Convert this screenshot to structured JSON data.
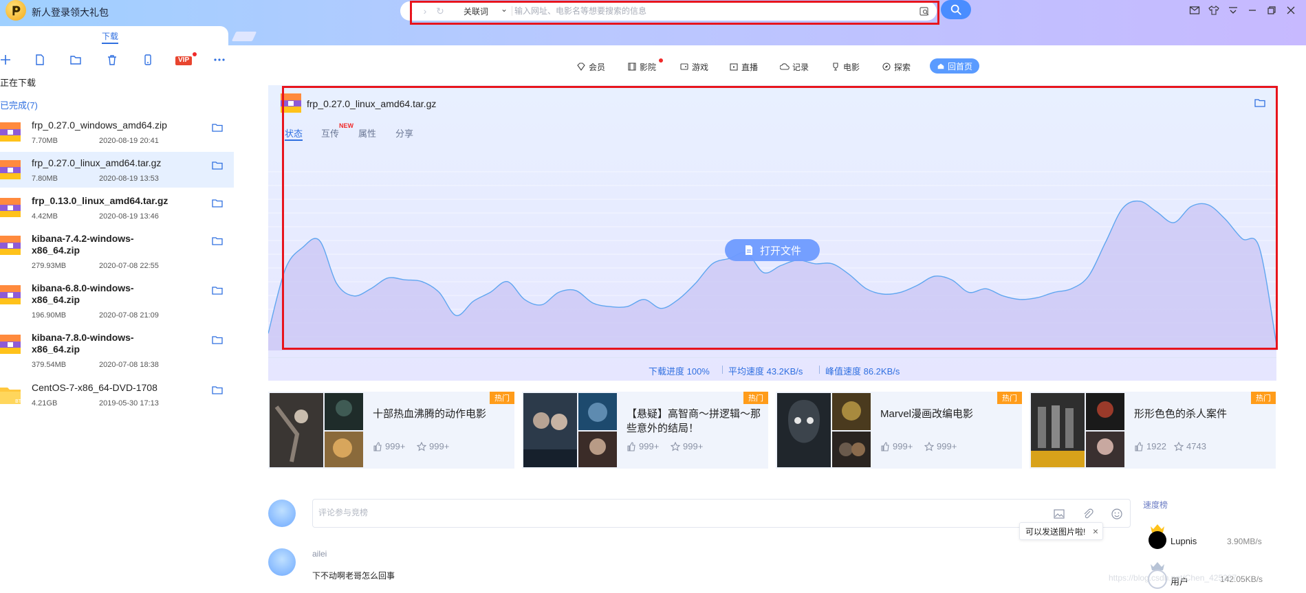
{
  "header": {
    "promo": "新人登录领大礼包",
    "search": {
      "keyword_mode": "关联词",
      "placeholder": "输入网址、电影名等想要搜索的信息"
    }
  },
  "sidebar": {
    "tab": "下载",
    "toolbar": [
      "add",
      "file",
      "folder",
      "delete",
      "mobile",
      "vip",
      "more"
    ],
    "vip_label": "VIP",
    "downloading_label": "正在下载",
    "completed_label": "已完成(7)",
    "items": [
      {
        "name": "frp_0.27.0_windows_amd64.zip",
        "size": "7.70MB",
        "date": "2020-08-19 20:41",
        "bold": false,
        "type": "archive"
      },
      {
        "name": "frp_0.27.0_linux_amd64.tar.gz",
        "size": "7.80MB",
        "date": "2020-08-19 13:53",
        "bold": false,
        "type": "archive",
        "selected": true
      },
      {
        "name": "frp_0.13.0_linux_amd64.tar.gz",
        "size": "4.42MB",
        "date": "2020-08-19 13:46",
        "bold": true,
        "type": "archive"
      },
      {
        "name": "kibana-7.4.2-windows-x86_64.zip",
        "size": "279.93MB",
        "date": "2020-07-08 22:55",
        "bold": true,
        "type": "archive"
      },
      {
        "name": "kibana-6.8.0-windows-x86_64.zip",
        "size": "196.90MB",
        "date": "2020-07-08 21:09",
        "bold": true,
        "type": "archive"
      },
      {
        "name": "kibana-7.8.0-windows-x86_64.zip",
        "size": "379.54MB",
        "date": "2020-07-08 18:38",
        "bold": true,
        "type": "archive"
      },
      {
        "name": "CentOS-7-x86_64-DVD-1708",
        "size": "4.21GB",
        "date": "2019-05-30 17:13",
        "bold": false,
        "type": "folder-bt"
      }
    ]
  },
  "nav": {
    "items": [
      "会员",
      "影院",
      "游戏",
      "直播",
      "记录",
      "电影",
      "探索"
    ],
    "home": "回首页"
  },
  "detail": {
    "filename": "frp_0.27.0_linux_amd64.tar.gz",
    "tabs": [
      "状态",
      "互传",
      "属性",
      "分享"
    ],
    "new_badge": "NEW",
    "open_button": "打开文件",
    "progress": "下载进度 100%",
    "avg_speed": "平均速度 43.2KB/s",
    "peak_speed": "峰值速度 86.2KB/s",
    "speed_curve": [
      0.08,
      0.44,
      0.56,
      0.6,
      0.36,
      0.29,
      0.33,
      0.39,
      0.38,
      0.37,
      0.31,
      0.18,
      0.26,
      0.31,
      0.37,
      0.27,
      0.24,
      0.31,
      0.32,
      0.25,
      0.23,
      0.23,
      0.27,
      0.22,
      0.27,
      0.36,
      0.47,
      0.5,
      0.53,
      0.42,
      0.46,
      0.49,
      0.47,
      0.47,
      0.41,
      0.33,
      0.3,
      0.31,
      0.35,
      0.4,
      0.38,
      0.31,
      0.33,
      0.29,
      0.27,
      0.28,
      0.31,
      0.33,
      0.4,
      0.59,
      0.78,
      0.82,
      0.76,
      0.7,
      0.79,
      0.8,
      0.72,
      0.61,
      0.56,
      0.02
    ]
  },
  "recommendations": [
    {
      "title": "十部热血沸腾的动作电影",
      "badge": "热门",
      "likes": "999+",
      "stars": "999+"
    },
    {
      "title": "【悬疑】高智商～拼逻辑～那些意外的结局！",
      "badge": "热门",
      "likes": "999+",
      "stars": "999+"
    },
    {
      "title": "Marvel漫画改编电影",
      "badge": "热门",
      "likes": "999+",
      "stars": "999+"
    },
    {
      "title": "形形色色的杀人案件",
      "badge": "热门",
      "likes": "1922",
      "stars": "4743"
    }
  ],
  "comments": {
    "placeholder": "评论参与竞榜",
    "tooltip": "可以发送图片啦!",
    "entries": [
      {
        "user": "ailei",
        "text": "下不动啊老哥怎么回事"
      }
    ]
  },
  "ranking": {
    "title": "速度榜",
    "items": [
      {
        "name": "Lupnis",
        "speed": "3.90MB/s"
      },
      {
        "name": "用户",
        "speed": "142.05KB/s"
      }
    ]
  },
  "watermark": "https://blog.csdn.net/Chen_425287",
  "colors": {
    "accent": "#2f6fe0",
    "highlight_box": "#e8141d",
    "hot_badge": "#ff9c1a",
    "chart_fill": "#c9c4f4",
    "chart_line": "#5fa6f0"
  }
}
